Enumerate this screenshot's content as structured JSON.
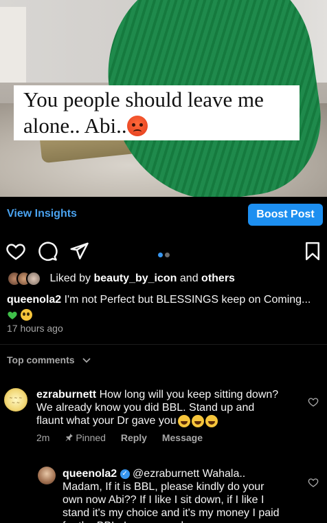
{
  "post": {
    "image_overlay_text": "You people should leave me alone.. Abi..",
    "view_insights_label": "View Insights",
    "boost_label": "Boost Post",
    "liked_by_prefix": "Liked by",
    "liked_by_user": "beauty_by_icon",
    "liked_by_and": "and",
    "liked_by_others": "others",
    "author": "queenola2",
    "caption_text": "I'm not Perfect but BLESSINGS keep on Coming...",
    "timestamp": "17 hours ago",
    "carousel_dots": {
      "count": 2,
      "active_index": 0
    }
  },
  "comments_section": {
    "header": "Top comments"
  },
  "comments": [
    {
      "username": "ezraburnett",
      "text": "How long will you keep sitting down? We already know you did BBL. Stand up and flaunt what your Dr gave you",
      "age": "2m",
      "pinned_label": "Pinned",
      "reply_label": "Reply",
      "message_label": "Message"
    },
    {
      "username": "queenola2",
      "mention": "@ezraburnett",
      "text": "Wahala.. Madam, If it is BBL, please kindly do your own now Abi?? If I like I sit down, if I like I stand it's my choice and it's my money I paid for the BBL. Leave me alone now"
    }
  ],
  "colors": {
    "accent_blue": "#1d8ff0",
    "link_blue": "#4aa3f0",
    "background": "#000000",
    "muted_text": "#a8a8a8"
  },
  "icons": [
    "heart-icon",
    "comment-icon",
    "share-icon",
    "bookmark-icon",
    "pin-icon",
    "chevron-down-icon",
    "verified-icon"
  ]
}
